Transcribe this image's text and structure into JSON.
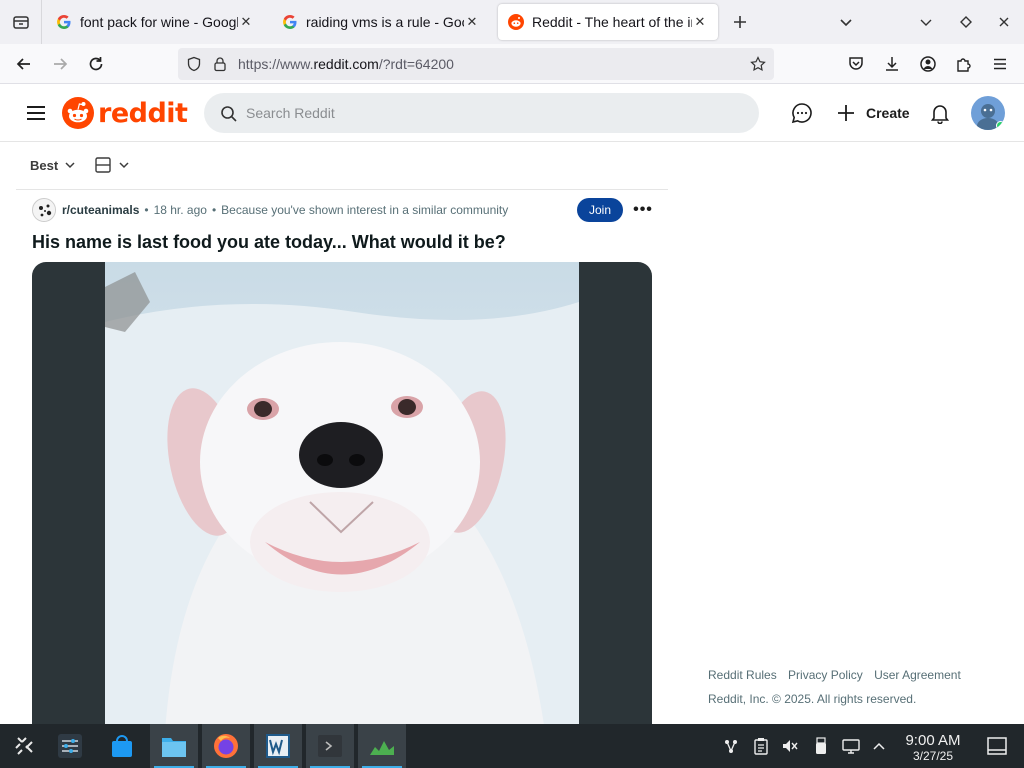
{
  "browser": {
    "tabs": [
      {
        "title": "font pack for wine - Google Search",
        "favicon": "google-icon",
        "active": false
      },
      {
        "title": "raiding vms is a rule - Google Search",
        "favicon": "google-icon",
        "active": false
      },
      {
        "title": "Reddit - The heart of the internet",
        "favicon": "reddit-icon",
        "active": true
      }
    ],
    "url_prefix": "https://www.",
    "url_domain": "reddit.com",
    "url_suffix": "/?rdt=64200"
  },
  "reddit": {
    "logo_text": "reddit",
    "search_placeholder": "Search Reddit",
    "create_label": "Create",
    "brand_color": "#ff4500",
    "sort_label": "Best"
  },
  "post": {
    "subreddit": "r/cuteanimals",
    "time": "18 hr. ago",
    "reason": "Because you've shown interest in a similar community",
    "join_label": "Join",
    "more_label": "•••",
    "title": "His name is last food you ate today... What would it be?"
  },
  "footer": {
    "links": [
      "Reddit Rules",
      "Privacy Policy",
      "User Agreement"
    ],
    "copyright": "Reddit, Inc. © 2025. All rights reserved."
  },
  "taskbar": {
    "time": "9:00 AM",
    "date": "3/27/25"
  }
}
